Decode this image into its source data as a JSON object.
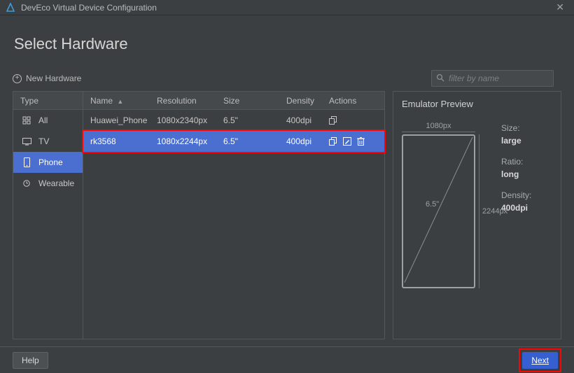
{
  "window": {
    "title": "DevEco Virtual Device Configuration"
  },
  "page": {
    "title": "Select Hardware",
    "new_hardware": "New Hardware"
  },
  "search": {
    "placeholder": "filter by name"
  },
  "sidebar": {
    "header": "Type",
    "items": [
      {
        "icon": "grid-icon",
        "label": "All"
      },
      {
        "icon": "tv-icon",
        "label": "TV"
      },
      {
        "icon": "phone-icon",
        "label": "Phone",
        "selected": true
      },
      {
        "icon": "watch-icon",
        "label": "Wearable"
      }
    ]
  },
  "table": {
    "headers": {
      "name": "Name",
      "resolution": "Resolution",
      "size": "Size",
      "density": "Density",
      "actions": "Actions"
    },
    "rows": [
      {
        "name": "Huawei_Phone",
        "resolution": "1080x2340px",
        "size": "6.5\"",
        "density": "400dpi",
        "selected": false
      },
      {
        "name": "rk3568",
        "resolution": "1080x2244px",
        "size": "6.5\"",
        "density": "400dpi",
        "selected": true
      }
    ]
  },
  "preview": {
    "title": "Emulator Preview",
    "width_label": "1080px",
    "height_label": "2244px",
    "diag_label": "6.5\"",
    "specs": {
      "size_label": "Size:",
      "size_value": "large",
      "ratio_label": "Ratio:",
      "ratio_value": "long",
      "density_label": "Density:",
      "density_value": "400dpi"
    }
  },
  "footer": {
    "help": "Help",
    "next": "Next"
  }
}
